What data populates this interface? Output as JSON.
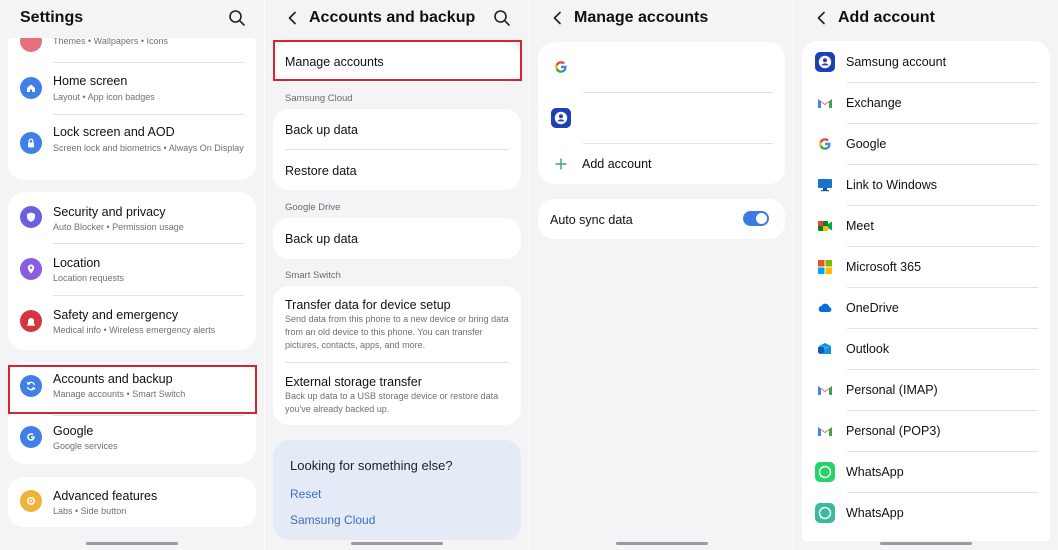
{
  "settings": {
    "title": "Settings",
    "items": [
      {
        "label": "",
        "sub": "Themes  •  Wallpapers  •  Icons"
      },
      {
        "label": "Home screen",
        "sub": "Layout  •  App icon badges"
      },
      {
        "label": "Lock screen and AOD",
        "sub": "Screen lock and biometrics  •  Always On Display"
      },
      {
        "label": "Security and privacy",
        "sub": "Auto Blocker  •  Permission usage"
      },
      {
        "label": "Location",
        "sub": "Location requests"
      },
      {
        "label": "Safety and emergency",
        "sub": "Medical info  •  Wireless emergency alerts"
      },
      {
        "label": "Accounts and backup",
        "sub": "Manage accounts  •  Smart Switch"
      },
      {
        "label": "Google",
        "sub": "Google services"
      },
      {
        "label": "Advanced features",
        "sub": "Labs  •  Side button"
      }
    ]
  },
  "accounts_backup": {
    "title": "Accounts and backup",
    "manage_accounts": "Manage accounts",
    "samsung_cloud_header": "Samsung Cloud",
    "back_up_data": "Back up data",
    "restore_data": "Restore data",
    "google_drive_header": "Google Drive",
    "gd_back_up_data": "Back up data",
    "smart_switch_header": "Smart Switch",
    "transfer_title": "Transfer data for device setup",
    "transfer_desc": "Send data from this phone to a new device or bring data from an old device to this phone. You can transfer pictures, contacts, apps, and more.",
    "external_title": "External storage transfer",
    "external_desc": "Back up data to a USB storage device or restore data you've already backed up.",
    "looking_title": "Looking for something else?",
    "links": [
      "Reset",
      "Samsung Cloud"
    ]
  },
  "manage_accounts": {
    "title": "Manage accounts",
    "add_account": "Add account",
    "auto_sync": "Auto sync data",
    "auto_sync_on": true
  },
  "add_account": {
    "title": "Add account",
    "items": [
      "Samsung account",
      "Exchange",
      "Google",
      "Link to Windows",
      "Meet",
      "Microsoft 365",
      "OneDrive",
      "Outlook",
      "Personal (IMAP)",
      "Personal (POP3)",
      "WhatsApp",
      "WhatsApp"
    ]
  },
  "colors": {
    "highlight": "#d5262f",
    "toggle_on": "#3e7be0",
    "link": "#3a6fc4"
  }
}
